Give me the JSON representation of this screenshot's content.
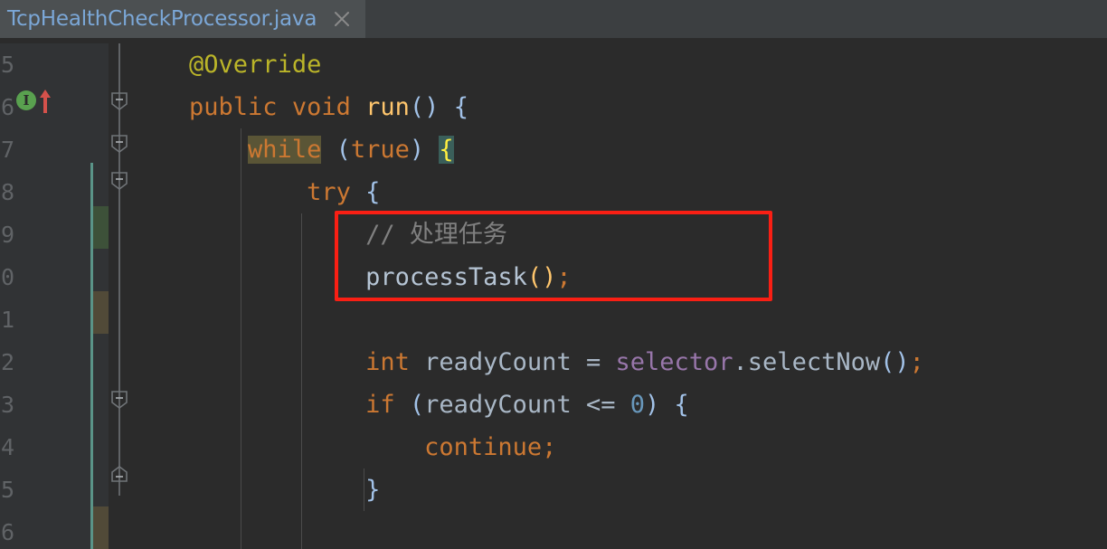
{
  "window": {
    "theme": "darcula",
    "background": "#2b2b2b"
  },
  "tabbar": {
    "background": "#3c3f41",
    "active_tab": {
      "label": "TcpHealthCheckProcessor.java",
      "background": "#4c5052",
      "text_color": "#7ba7d7",
      "underline_color": "#4a88c7",
      "close_icon": "close-icon"
    }
  },
  "gutter": {
    "background": "#313335",
    "line_numbers": [
      "5",
      "6",
      "7",
      "8",
      "9",
      "0",
      "1",
      "2",
      "3",
      "4",
      "5",
      "6"
    ],
    "markers": [
      {
        "icon": "implementing-method-icon",
        "label": "I",
        "color": "#59a14f",
        "line_index": 1
      },
      {
        "icon": "arrow-up-icon",
        "color": "#d4514b",
        "line_index": 1
      }
    ],
    "change_bars": [
      {
        "color": "#3d5139",
        "kind": "added"
      },
      {
        "color": "#514a38",
        "kind": "modified"
      },
      {
        "color": "#514a38",
        "kind": "modified"
      }
    ],
    "vcs_line_color": "#5a9488",
    "fold_markers": [
      "fold-collapse-icon",
      "fold-collapse-icon",
      "fold-collapse-icon",
      "fold-collapse-icon",
      "fold-end-icon"
    ]
  },
  "annotation": {
    "shape": "rectangle",
    "color": "#f91f14",
    "border_width": "4px",
    "surrounds": [
      "// 处理任务",
      "processTask();"
    ]
  },
  "code": {
    "language": "java",
    "lines": [
      {
        "indent": 0,
        "tokens": [
          {
            "text": "    ",
            "cls": "t-punc"
          },
          {
            "text": "@Override",
            "cls": "t-annotation"
          }
        ]
      },
      {
        "indent": 0,
        "tokens": [
          {
            "text": "    ",
            "cls": "t-punc"
          },
          {
            "text": "public",
            "cls": "t-keyword"
          },
          {
            "text": " ",
            "cls": "t-punc"
          },
          {
            "text": "void",
            "cls": "t-keyword"
          },
          {
            "text": " ",
            "cls": "t-punc"
          },
          {
            "text": "run",
            "cls": "t-method"
          },
          {
            "text": "()",
            "cls": "t-paren"
          },
          {
            "text": " ",
            "cls": "t-punc"
          },
          {
            "text": "{",
            "cls": "t-brace"
          }
        ]
      },
      {
        "indent": 1,
        "tokens": [
          {
            "text": "        ",
            "cls": "t-punc"
          },
          {
            "text": "while",
            "cls": "t-keyword hl-while"
          },
          {
            "text": " ",
            "cls": "t-punc"
          },
          {
            "text": "(",
            "cls": "t-paren"
          },
          {
            "text": "true",
            "cls": "t-keyword"
          },
          {
            "text": ")",
            "cls": "t-paren"
          },
          {
            "text": " ",
            "cls": "t-punc"
          },
          {
            "text": "{",
            "cls": "hl-brace"
          }
        ]
      },
      {
        "indent": 2,
        "tokens": [
          {
            "text": "            ",
            "cls": "t-punc"
          },
          {
            "text": "try",
            "cls": "t-keyword"
          },
          {
            "text": " ",
            "cls": "t-punc"
          },
          {
            "text": "{",
            "cls": "t-brace"
          }
        ]
      },
      {
        "indent": 3,
        "tokens": [
          {
            "text": "                ",
            "cls": "t-punc"
          },
          {
            "text": "// 处理任务",
            "cls": "t-comment"
          }
        ]
      },
      {
        "indent": 3,
        "tokens": [
          {
            "text": "                ",
            "cls": "t-punc"
          },
          {
            "text": "processTask",
            "cls": "t-call"
          },
          {
            "text": "()",
            "cls": "t-method"
          },
          {
            "text": ";",
            "cls": "t-keyword"
          }
        ]
      },
      {
        "indent": 3,
        "tokens": []
      },
      {
        "indent": 3,
        "tokens": [
          {
            "text": "                ",
            "cls": "t-punc"
          },
          {
            "text": "int",
            "cls": "t-keyword"
          },
          {
            "text": " ",
            "cls": "t-punc"
          },
          {
            "text": "readyCount",
            "cls": "t-ident"
          },
          {
            "text": " = ",
            "cls": "t-punc"
          },
          {
            "text": "selector",
            "cls": "t-field"
          },
          {
            "text": ".",
            "cls": "t-punc"
          },
          {
            "text": "selectNow",
            "cls": "t-ident"
          },
          {
            "text": "()",
            "cls": "t-paren"
          },
          {
            "text": ";",
            "cls": "t-keyword"
          }
        ]
      },
      {
        "indent": 3,
        "tokens": [
          {
            "text": "                ",
            "cls": "t-punc"
          },
          {
            "text": "if",
            "cls": "t-keyword"
          },
          {
            "text": " ",
            "cls": "t-punc"
          },
          {
            "text": "(",
            "cls": "t-paren"
          },
          {
            "text": "readyCount",
            "cls": "t-ident"
          },
          {
            "text": " <= ",
            "cls": "t-punc"
          },
          {
            "text": "0",
            "cls": "t-number"
          },
          {
            "text": ")",
            "cls": "t-paren"
          },
          {
            "text": " ",
            "cls": "t-punc"
          },
          {
            "text": "{",
            "cls": "t-brace"
          }
        ]
      },
      {
        "indent": 4,
        "tokens": [
          {
            "text": "                    ",
            "cls": "t-punc"
          },
          {
            "text": "continue",
            "cls": "t-keyword"
          },
          {
            "text": ";",
            "cls": "t-keyword"
          }
        ]
      },
      {
        "indent": 3,
        "tokens": [
          {
            "text": "                ",
            "cls": "t-punc"
          },
          {
            "text": "}",
            "cls": "t-brace"
          }
        ]
      },
      {
        "indent": 3,
        "tokens": []
      }
    ]
  }
}
